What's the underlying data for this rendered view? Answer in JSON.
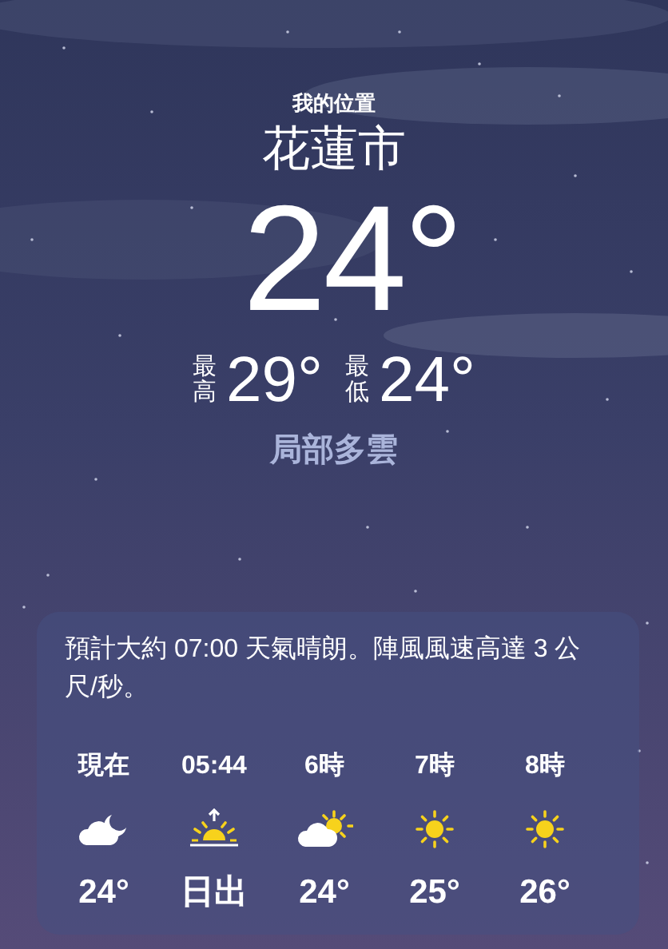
{
  "location": {
    "caption": "我的位置",
    "city": "花蓮市",
    "temperature": "24°",
    "high": {
      "label": "最高",
      "value": "29°"
    },
    "low": {
      "label": "最低",
      "value": "24°"
    },
    "condition": "局部多雲"
  },
  "forecast": {
    "summary": "預計大約 07:00 天氣晴朗。陣風風速高達 3 公尺/秒。",
    "hours": [
      {
        "label": "現在",
        "kind": "cloud-moon",
        "value": "24°"
      },
      {
        "label": "05:44",
        "kind": "sunrise",
        "value": "日出"
      },
      {
        "label": "6時",
        "kind": "cloud-sun",
        "value": "24°"
      },
      {
        "label": "7時",
        "kind": "sun",
        "value": "25°"
      },
      {
        "label": "8時",
        "kind": "sun",
        "value": "26°"
      }
    ]
  }
}
